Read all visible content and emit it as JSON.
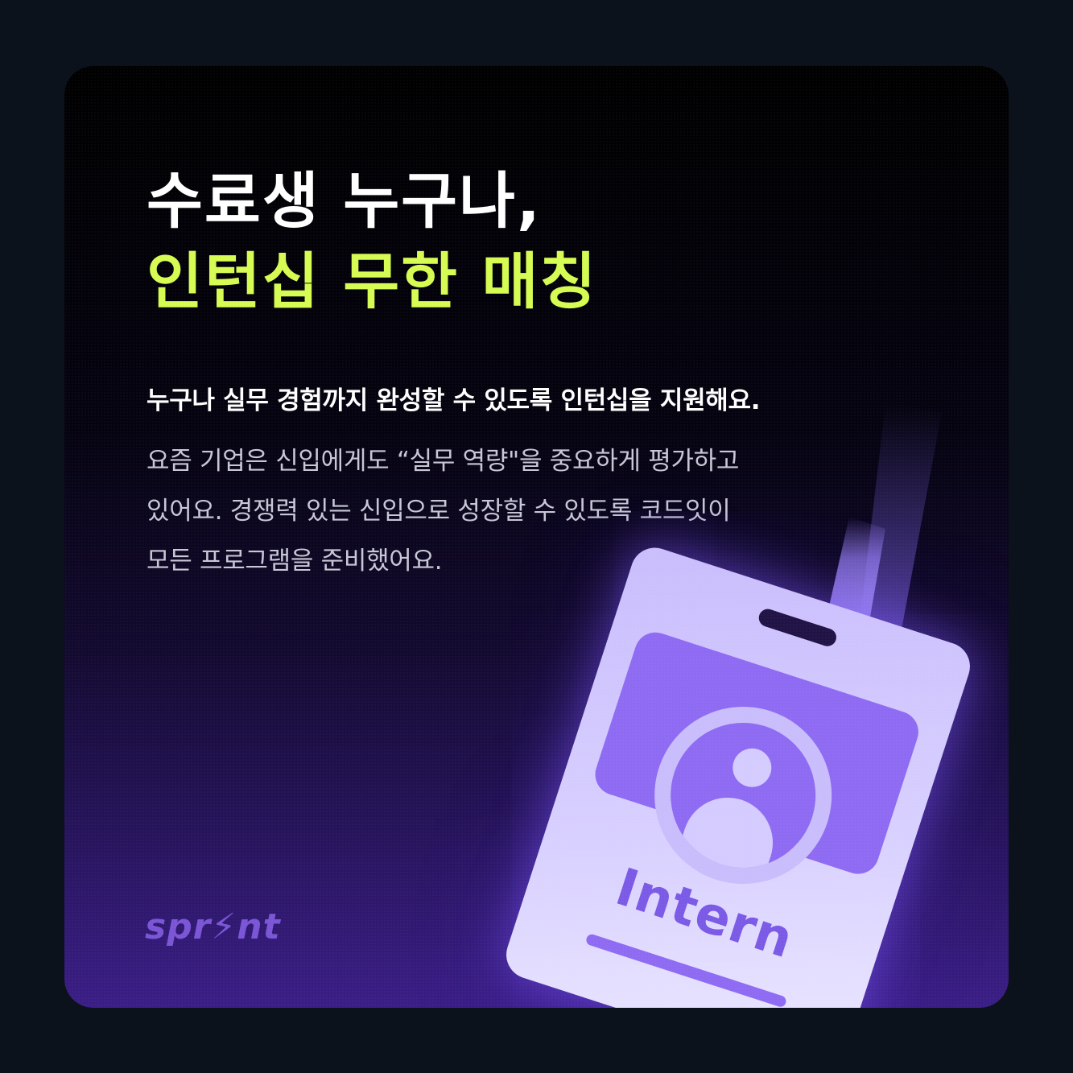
{
  "headline": {
    "line1": "수료생 누구나,",
    "line2": "인턴십 무한 매칭"
  },
  "subhead": "누구나 실무 경험까지 완성할 수 있도록 인턴십을 지원해요.",
  "description": {
    "lines": [
      "요즘 기업은 신입에게도 “실무 역량\"을 중요하게 평가하고",
      "있어요. 경쟁력 있는 신입으로 성장할 수 있도록 코드잇이",
      "모든 프로그램을 준비했어요."
    ]
  },
  "logo": {
    "text": "spr⚡nt"
  },
  "badge": {
    "label": "Intern"
  },
  "colors": {
    "page_background": "#0c121c",
    "headline_white": "#ffffff",
    "headline_accent": "#d6fb52",
    "badge_purple": "#8e6bf2",
    "badge_light": "#d8d0ff",
    "logo_purple": "#7a56d6"
  }
}
